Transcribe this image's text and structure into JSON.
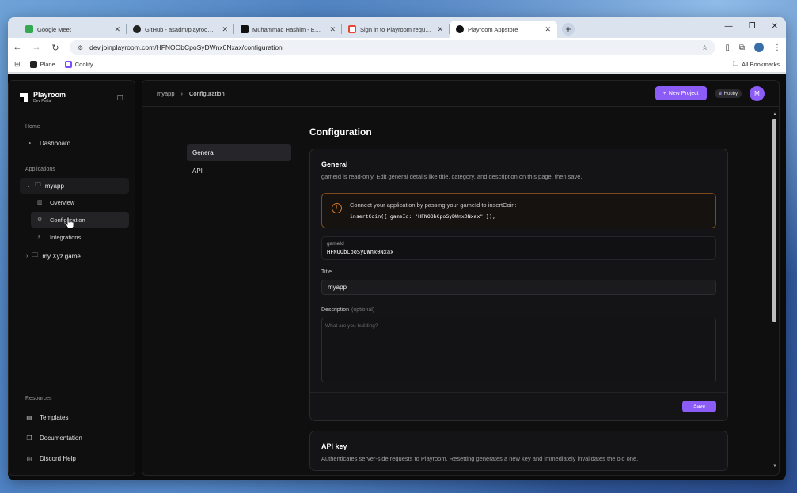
{
  "browser": {
    "tabs": [
      {
        "label": "Google Meet",
        "favicon_color": "#34a853"
      },
      {
        "label": "GitHub - asadm/playroom-doc",
        "favicon_color": "#222222"
      },
      {
        "label": "Muhammad Hashim - EMP-CKI",
        "favicon_color": "#111111"
      },
      {
        "label": "Sign in to Playroom requested",
        "favicon_color": "#ea4335"
      },
      {
        "label": "Playroom Appstore",
        "favicon_color": "#111111"
      }
    ],
    "url": "dev.joinplayroom.com/HFNOObCpoSyDWnx0Nxax/configuration",
    "bookmarks": [
      {
        "label": "Plane"
      },
      {
        "label": "Coolify"
      }
    ],
    "all_bookmarks": "All Bookmarks"
  },
  "sidebar": {
    "brand_name": "Playroom",
    "brand_sub": "Dev Portal",
    "home_label": "Home",
    "dashboard": "Dashboard",
    "applications_label": "Applications",
    "apps": [
      {
        "name": "myapp",
        "expanded": true,
        "children": [
          "Overview",
          "Configuration",
          "Integrations"
        ]
      },
      {
        "name": "my Xyz game",
        "expanded": false
      }
    ],
    "resources_label": "Resources",
    "resources": [
      "Templates",
      "Documentation",
      "Discord Help"
    ]
  },
  "topbar": {
    "breadcrumb_root": "myapp",
    "breadcrumb_current": "Configuration",
    "new_project": "New Project",
    "plan_badge": "Hobby",
    "user_initial": "M",
    "accent": "#8b5cf6"
  },
  "subnav": [
    "General",
    "API"
  ],
  "page": {
    "title": "Configuration",
    "general": {
      "heading": "General",
      "description": "gameId is read-only. Edit general details like title, category, and description on this page, then save.",
      "callout_text": "Connect your application by passing your gameId to insertCoin:",
      "callout_code": "insertCoin({ gameId: \"HFNOObCpoSyDWnx0Nxax\" });",
      "gameid_label": "gameId",
      "gameid_value": "HFNOObCpoSyDWnx0Nxax",
      "title_label": "Title",
      "title_value": "myapp",
      "description_label": "Description",
      "description_optional": "(optional)",
      "description_placeholder": "What are you building?",
      "save": "Save"
    },
    "api_key": {
      "heading": "API key",
      "description": "Authenticates server-side requests to Playroom. Resetting generates a new key and immediately invalidates the old one."
    }
  }
}
